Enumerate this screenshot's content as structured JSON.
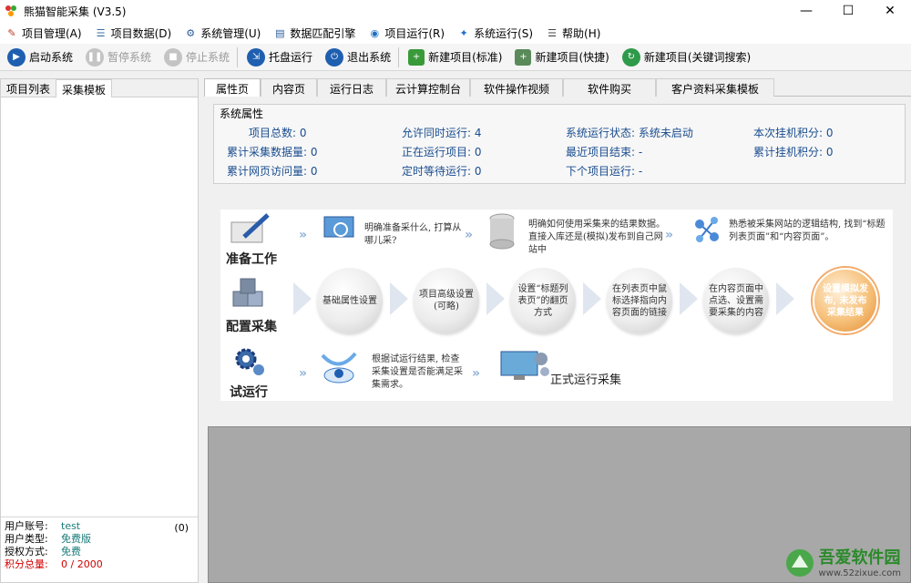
{
  "window": {
    "title": "熊猫智能采集 (V3.5)"
  },
  "menu": [
    {
      "icon": "tools-icon",
      "label": "项目管理(A)"
    },
    {
      "icon": "list-icon",
      "label": "项目数据(D)"
    },
    {
      "icon": "gear-icon",
      "label": "系统管理(U)"
    },
    {
      "icon": "chart-icon",
      "label": "数据匹配引擎"
    },
    {
      "icon": "globe-icon",
      "label": "项目运行(R)"
    },
    {
      "icon": "run-icon",
      "label": "系统运行(S)"
    },
    {
      "icon": "help-icon",
      "label": "帮助(H)"
    }
  ],
  "toolbar": {
    "start": "启动系统",
    "pause": "暂停系统",
    "stop": "停止系统",
    "tray": "托盘运行",
    "exit": "退出系统",
    "new_standard": "新建项目(标准)",
    "new_quick": "新建项目(快捷)",
    "new_keyword": "新建项目(关键词搜索)"
  },
  "left_tabs": [
    "项目列表",
    "采集模板"
  ],
  "user": {
    "account_label": "用户账号:",
    "account": "test",
    "count": "(0)",
    "type_label": "用户类型:",
    "type": "免费版",
    "auth_label": "授权方式:",
    "auth": "免费",
    "points_label": "积分总量:",
    "points": "0 / 2000"
  },
  "tabs": [
    "属性页",
    "内容页",
    "运行日志",
    "云计算控制台",
    "软件操作视频",
    "软件购买",
    "客户资料采集模板"
  ],
  "props": {
    "legend": "系统属性",
    "total": "项目总数: 0",
    "concurrent": "允许同时运行: 4",
    "status": "系统运行状态: 系统未启动",
    "session_points": "本次挂机积分: 0",
    "collected": "累计采集数据量: 0",
    "running": "正在运行项目: 0",
    "last_finished": "最近项目结束: -",
    "total_points": "累计挂机积分: 0",
    "visits": "累计网页访问量: 0",
    "timed_wait": "定时等待运行: 0",
    "next_run": "下个项目运行: -"
  },
  "flow": {
    "prepare_title": "准备工作",
    "prepare_note1": "明确准备采什么, 打算从哪儿采?",
    "prepare_note2": "明确如何使用采集来的结果数据。直接入库还是(模拟)发布到自己网站中",
    "prepare_note3": "熟悉被采集网站的逻辑结构, 找到“标题列表页面”和“内容页面”。",
    "config_title": "配置采集",
    "step1": "基础属性设置",
    "step2": "项目高级设置(可略)",
    "step3": "设置“标题列表页”的翻页方式",
    "step4": "在列表页中鼠标选择指向内容页面的链接",
    "step5": "在内容页面中点选、设置需要采集的内容",
    "step6": "设置模拟发布, 未发布采集结果",
    "test_title": "试运行",
    "test_note": "根据试运行结果, 检查采集设置是否能满足采集需求。",
    "formal": "正式运行采集"
  },
  "watermark": {
    "text": "吾爱软件园",
    "url": "www.52zixue.com"
  }
}
